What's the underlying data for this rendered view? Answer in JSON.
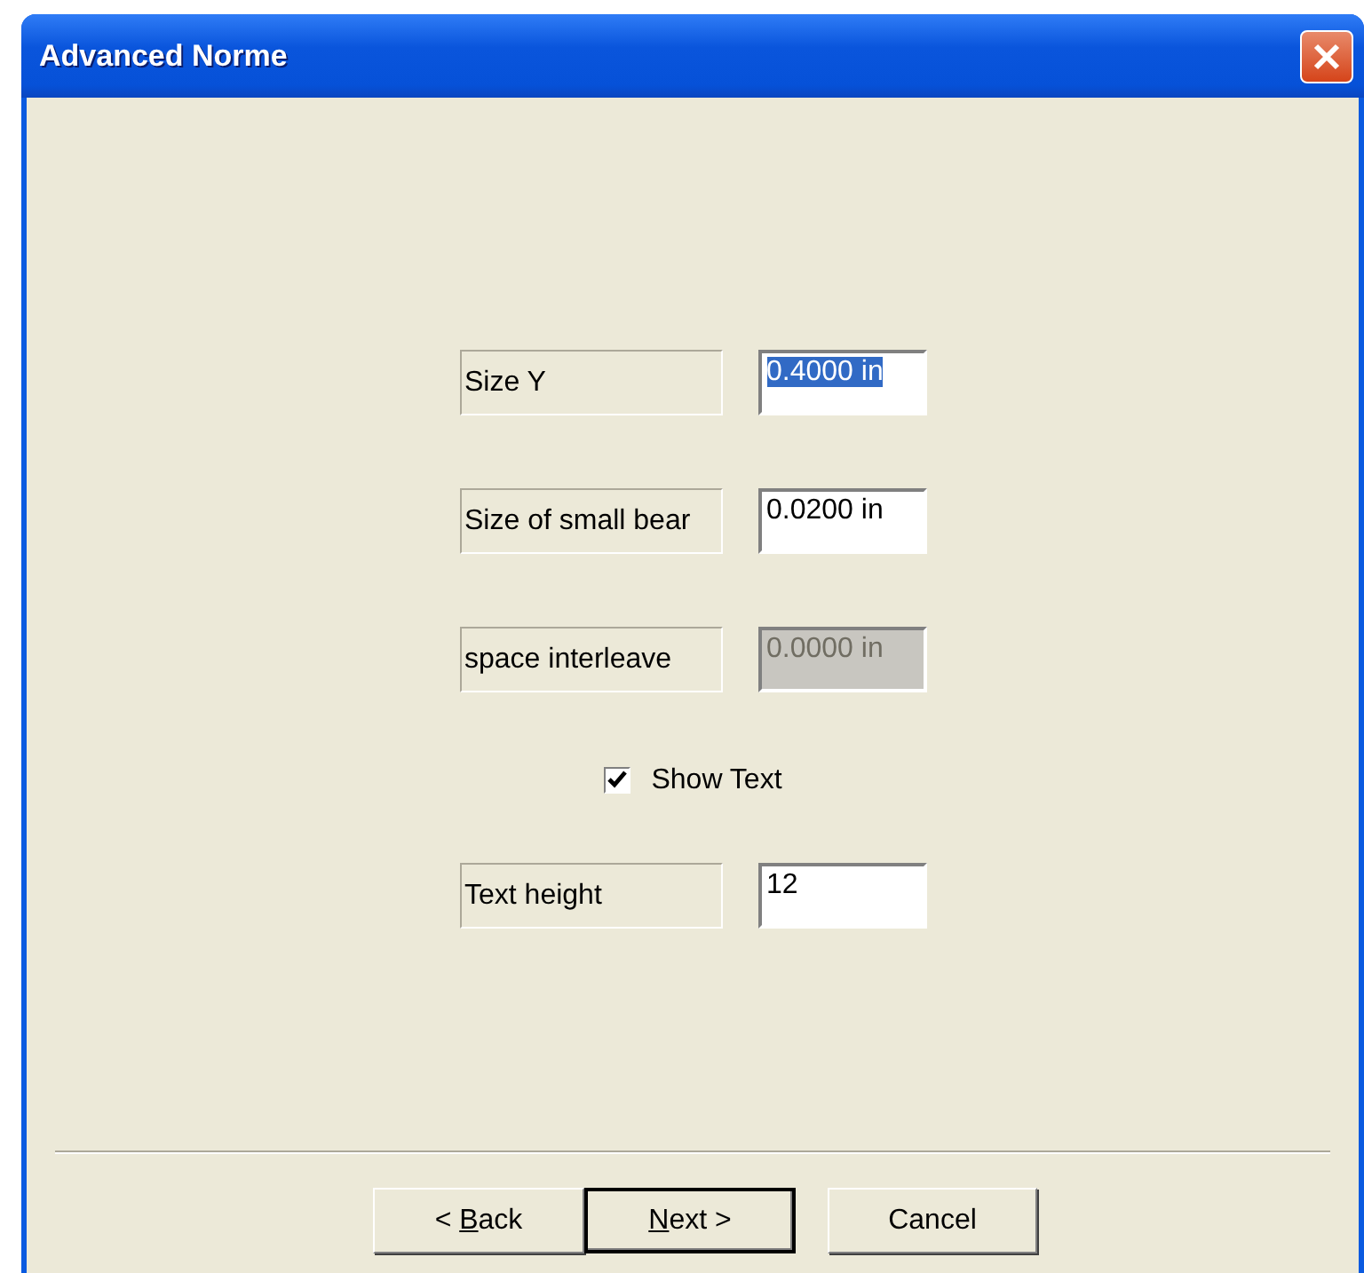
{
  "window": {
    "title": "Advanced Norme"
  },
  "rows": [
    {
      "kind": "field",
      "label": "Size Y",
      "value": "0.4000 in",
      "disabled": false,
      "highlighted": true
    },
    {
      "kind": "field",
      "label": "Size of small bear",
      "value": "0.0200 in",
      "disabled": false,
      "highlighted": false
    },
    {
      "kind": "field",
      "label": "space interleave",
      "value": "0.0000 in",
      "disabled": true,
      "highlighted": false
    },
    {
      "kind": "checkbox",
      "label": "Show Text",
      "checked": true
    },
    {
      "kind": "field",
      "label": "Text height",
      "value": "12",
      "disabled": false,
      "highlighted": false
    }
  ],
  "buttons": [
    {
      "before": "< ",
      "accel": "B",
      "after": "ack",
      "default": false
    },
    {
      "accel": "N",
      "after": "ext >",
      "default": true
    },
    {
      "before": "Cancel",
      "default": false
    }
  ]
}
